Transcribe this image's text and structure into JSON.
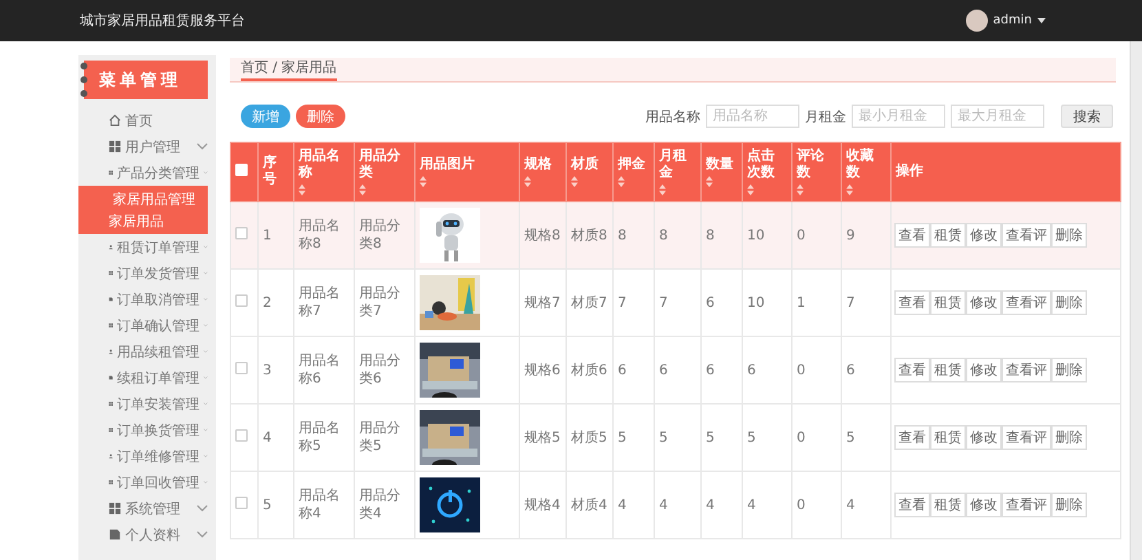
{
  "topbar": {
    "title": "城市家居用品租赁服务平台",
    "user": "admin"
  },
  "sidebar": {
    "banner": "菜单管理",
    "items": [
      {
        "label": "首页",
        "selected": false
      },
      {
        "label": "用户管理",
        "expanded": false,
        "selected": false
      },
      {
        "label": "产品分类管理",
        "expanded": false,
        "selected": false
      },
      {
        "label": "家居用品管理",
        "expanded": true,
        "selected": true,
        "children": [
          {
            "label": "家居用品",
            "selected": true
          }
        ]
      },
      {
        "label": "租赁订单管理",
        "expanded": false,
        "selected": false
      },
      {
        "label": "订单发货管理",
        "expanded": false,
        "selected": false
      },
      {
        "label": "订单取消管理",
        "expanded": false,
        "selected": false
      },
      {
        "label": "订单确认管理",
        "expanded": false,
        "selected": false
      },
      {
        "label": "用品续租管理",
        "expanded": false,
        "selected": false
      },
      {
        "label": "续租订单管理",
        "expanded": false,
        "selected": false
      },
      {
        "label": "订单安装管理",
        "expanded": false,
        "selected": false
      },
      {
        "label": "订单换货管理",
        "expanded": false,
        "selected": false
      },
      {
        "label": "订单维修管理",
        "expanded": false,
        "selected": false
      },
      {
        "label": "订单回收管理",
        "expanded": false,
        "selected": false
      },
      {
        "label": "系统管理",
        "expanded": false,
        "selected": false
      },
      {
        "label": "个人资料",
        "expanded": false,
        "selected": false
      }
    ]
  },
  "breadcrumb": "首页 / 家居用品",
  "toolbar": {
    "add": "新增",
    "delete": "删除",
    "name_label": "用品名称",
    "name_placeholder": "用品名称",
    "rent_label": "月租金",
    "min_placeholder": "最小月租金",
    "max_placeholder": "最大月租金",
    "search": "搜索"
  },
  "table": {
    "select_all_checked": false,
    "columns": [
      {
        "label": "序号",
        "sortable": false
      },
      {
        "label": "用品名称",
        "sortable": true
      },
      {
        "label": "用品分类",
        "sortable": true
      },
      {
        "label": "用品图片",
        "sortable": true
      },
      {
        "label": "规格",
        "sortable": true
      },
      {
        "label": "材质",
        "sortable": true
      },
      {
        "label": "押金",
        "sortable": true
      },
      {
        "label": "月租金",
        "sortable": true
      },
      {
        "label": "数量",
        "sortable": true
      },
      {
        "label": "点击次数",
        "sortable": true
      },
      {
        "label": "评论数",
        "sortable": true
      },
      {
        "label": "收藏数",
        "sortable": true
      },
      {
        "label": "操作",
        "sortable": false
      }
    ],
    "rows": [
      {
        "checked": false,
        "hovered": true,
        "cells": [
          "1",
          "用品名称8",
          "用品分类8",
          "",
          "规格8",
          "材质8",
          "8",
          "8",
          "8",
          "10",
          "0",
          "9"
        ],
        "actions": [
          "查看",
          "租赁",
          "修改",
          "查看评",
          "删除"
        ]
      },
      {
        "checked": false,
        "hovered": false,
        "cells": [
          "2",
          "用品名称7",
          "用品分类7",
          "",
          "规格7",
          "材质7",
          "7",
          "7",
          "6",
          "10",
          "1",
          "7"
        ],
        "actions": [
          "查看",
          "租赁",
          "修改",
          "查看评",
          "删除"
        ]
      },
      {
        "checked": false,
        "hovered": false,
        "cells": [
          "3",
          "用品名称6",
          "用品分类6",
          "",
          "规格6",
          "材质6",
          "6",
          "6",
          "6",
          "6",
          "0",
          "6"
        ],
        "actions": [
          "查看",
          "租赁",
          "修改",
          "查看评",
          "删除"
        ]
      },
      {
        "checked": false,
        "hovered": false,
        "cells": [
          "4",
          "用品名称5",
          "用品分类5",
          "",
          "规格5",
          "材质5",
          "5",
          "5",
          "5",
          "5",
          "0",
          "5"
        ],
        "actions": [
          "查看",
          "租赁",
          "修改",
          "查看评",
          "删除"
        ]
      },
      {
        "checked": false,
        "hovered": false,
        "cells": [
          "5",
          "用品名称4",
          "用品分类4",
          "",
          "规格4",
          "材质4",
          "4",
          "4",
          "4",
          "4",
          "0",
          "4"
        ],
        "actions": [
          "查看",
          "租赁",
          "修改",
          "查看评",
          "删除"
        ]
      }
    ]
  }
}
